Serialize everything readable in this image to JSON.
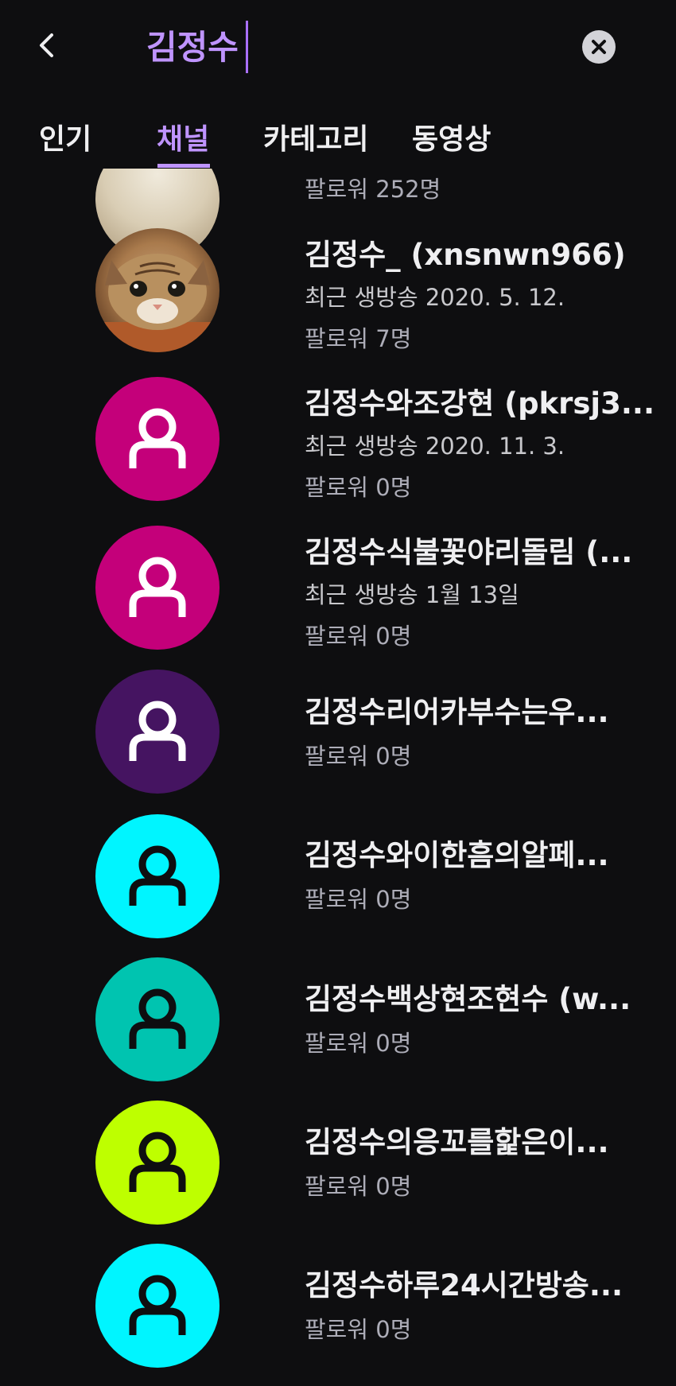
{
  "search": {
    "query": "김정수"
  },
  "tabs": [
    {
      "label": "인기"
    },
    {
      "label": "채널"
    },
    {
      "label": "카테고리"
    },
    {
      "label": "동영상"
    }
  ],
  "partial_row": {
    "followers": "팔로워 252명"
  },
  "channels": [
    {
      "name": "김정수_ (xnsnwn966)",
      "last_live": "최근 생방송 2020. 5. 12.",
      "followers": "팔로워 7명",
      "avatar_color": "#a86b3a"
    },
    {
      "name": "김정수와조강현 (pkrsj3...",
      "last_live": "최근 생방송 2020. 11. 3.",
      "followers": "팔로워 0명",
      "avatar_color": "#c4007a"
    },
    {
      "name": "김정수식불꽃야리돌림 (...",
      "last_live": "최근 생방송 1월 13일",
      "followers": "팔로워 0명",
      "avatar_color": "#c4007a"
    },
    {
      "name": "김정수리어카부수는우...",
      "followers": "팔로워 0명",
      "avatar_color": "#451461"
    },
    {
      "name": "김정수와이한흠의알페...",
      "followers": "팔로워 0명",
      "avatar_color": "#00f5ff"
    },
    {
      "name": "김정수백상현조현수 (w...",
      "followers": "팔로워 0명",
      "avatar_color": "#00c4b0"
    },
    {
      "name": "김정수의응꼬를핥은이...",
      "followers": "팔로워 0명",
      "avatar_color": "#beff00"
    },
    {
      "name": "김정수하루24시간방송...",
      "followers": "팔로워 0명",
      "avatar_color": "#00f5ff"
    }
  ],
  "icons": {
    "back": "chevron-left-icon",
    "clear": "close-circle-icon",
    "avatar": "user-icon"
  },
  "colors": {
    "background": "#0e0e10",
    "accent": "#bf94ff"
  }
}
